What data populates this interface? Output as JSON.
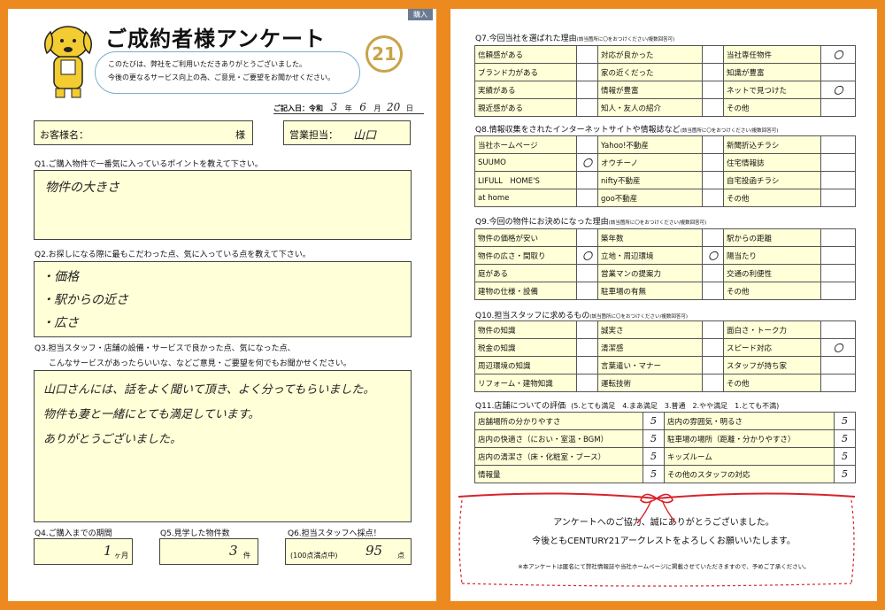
{
  "header": {
    "tag": "購入",
    "title": "ご成約者様アンケート",
    "greeting_1": "このたびは、弊社をご利用いただきありがとうございました。",
    "greeting_2": "今後の更なるサービス向上の為、ご意見・ご要望をお聞かせください。",
    "logo_number": "21",
    "date_label": "ご記入日：令和",
    "date_year": "3",
    "date_year_unit": "年",
    "date_month": "6",
    "date_month_unit": "月",
    "date_day": "20",
    "date_day_unit": "日"
  },
  "customer": {
    "name_label": "お客様名：",
    "name_suffix": "様",
    "staff_label": "営業担当：",
    "staff_value": "山口"
  },
  "q1": {
    "question": "Q1.ご購入物件で一番気に入っているポイントを教えて下さい。",
    "answer": "物件の大きさ"
  },
  "q2": {
    "question": "Q2.お探しになる際に最もこだわった点、気に入っている点を教えて下さい。",
    "answers": [
      "・価格",
      "・駅からの近さ",
      "・広さ"
    ]
  },
  "q3": {
    "question_1": "Q3.担当スタッフ・店舗の設備・サービスで良かった点、気になった点、",
    "question_2": "こんなサービスがあったらいいな、などご意見・ご要望を何でもお聞かせください。",
    "answers": [
      "山口さんには、話をよく聞いて頂き、よく分ってもらいました。",
      "物件も妻と一緒にとても満足しています。",
      "ありがとうございました。"
    ]
  },
  "q4": {
    "question": "Q4.ご購入までの期間",
    "value": "1",
    "unit": "ヶ月"
  },
  "q5": {
    "question": "Q5.見学した物件数",
    "value": "3",
    "unit": "件"
  },
  "q6": {
    "question": "Q6.担当スタッフへ採点！",
    "note": "(100点満点中)",
    "value": "95",
    "unit": "点"
  },
  "q7": {
    "question": "Q7.今回当社を選ばれた理由",
    "sub": "(該当箇所に〇をおつけください/複数回答可)",
    "rows": [
      [
        "信頼感がある",
        "",
        "対応が良かった",
        "",
        "当社専任物件",
        "〇"
      ],
      [
        "ブランド力がある",
        "",
        "家の近くだった",
        "",
        "知識が豊富",
        ""
      ],
      [
        "実績がある",
        "",
        "情報が豊富",
        "",
        "ネットで見つけた",
        "〇"
      ],
      [
        "親近感がある",
        "",
        "知人・友人の紹介",
        "",
        "その他",
        ""
      ]
    ]
  },
  "q8": {
    "question": "Q8.情報収集をされたインターネットサイトや情報誌など",
    "sub": "(該当箇所に〇をおつけください/複数回答可)",
    "rows": [
      [
        "当社ホームページ",
        "",
        "Yahoo!不動産",
        "",
        "新聞折込チラシ",
        ""
      ],
      [
        "SUUMO",
        "〇",
        "オウチーノ",
        "",
        "住宅情報誌",
        ""
      ],
      [
        "LIFULL　HOME'S",
        "",
        "nifty不動産",
        "",
        "自宅投函チラシ",
        ""
      ],
      [
        "at home",
        "",
        "goo不動産",
        "",
        "その他",
        ""
      ]
    ]
  },
  "q9": {
    "question": "Q9.今回の物件にお決めになった理由",
    "sub": "(該当箇所に〇をおつけください/複数回答可)",
    "rows": [
      [
        "物件の価格が安い",
        "",
        "築年数",
        "",
        "駅からの距離",
        ""
      ],
      [
        "物件の広さ・間取り",
        "〇",
        "立地・周辺環境",
        "〇",
        "陽当たり",
        ""
      ],
      [
        "庭がある",
        "",
        "営業マンの提案力",
        "",
        "交通の利便性",
        ""
      ],
      [
        "建物の仕様・設備",
        "",
        "駐車場の有無",
        "",
        "その他",
        ""
      ]
    ]
  },
  "q10": {
    "question": "Q10.担当スタッフに求めるもの",
    "sub": "(該当箇所に〇をおつけください/複数回答可)",
    "rows": [
      [
        "物件の知識",
        "",
        "誠実さ",
        "",
        "面白さ・トーク力",
        ""
      ],
      [
        "税金の知識",
        "",
        "清潔感",
        "",
        "スピード対応",
        "〇"
      ],
      [
        "周辺環境の知識",
        "",
        "言葉遣い・マナー",
        "",
        "スタッフが持ち家",
        ""
      ],
      [
        "リフォーム・建物知識",
        "",
        "運転技術",
        "",
        "その他",
        ""
      ]
    ]
  },
  "q11": {
    "question": "Q11.店舗についての評価",
    "scale": "(5.とても満足　4.まあ満足　3.普通　2.やや満足　1.とても不満)",
    "rows": [
      [
        "店舗場所の分かりやすさ",
        "5",
        "店内の雰囲気・明るさ",
        "5"
      ],
      [
        "店内の快適さ（におい・室温・BGM）",
        "5",
        "駐車場の場所（距離・分かりやすさ）",
        "5"
      ],
      [
        "店内の清潔さ（床・化粧室・ブース）",
        "5",
        "キッズルーム",
        "5"
      ],
      [
        "情報量",
        "5",
        "その他のスタッフの対応",
        "5"
      ]
    ]
  },
  "footer": {
    "thanks_1": "アンケートへのご協力、誠にありがとうございました。",
    "thanks_2": "今後ともCENTURY21アークレストをよろしくお願いいたします。",
    "note": "※本アンケートは匿名にて弊社情報誌や当社ホームページに掲載させていただきますので、予めご了承ください。"
  }
}
